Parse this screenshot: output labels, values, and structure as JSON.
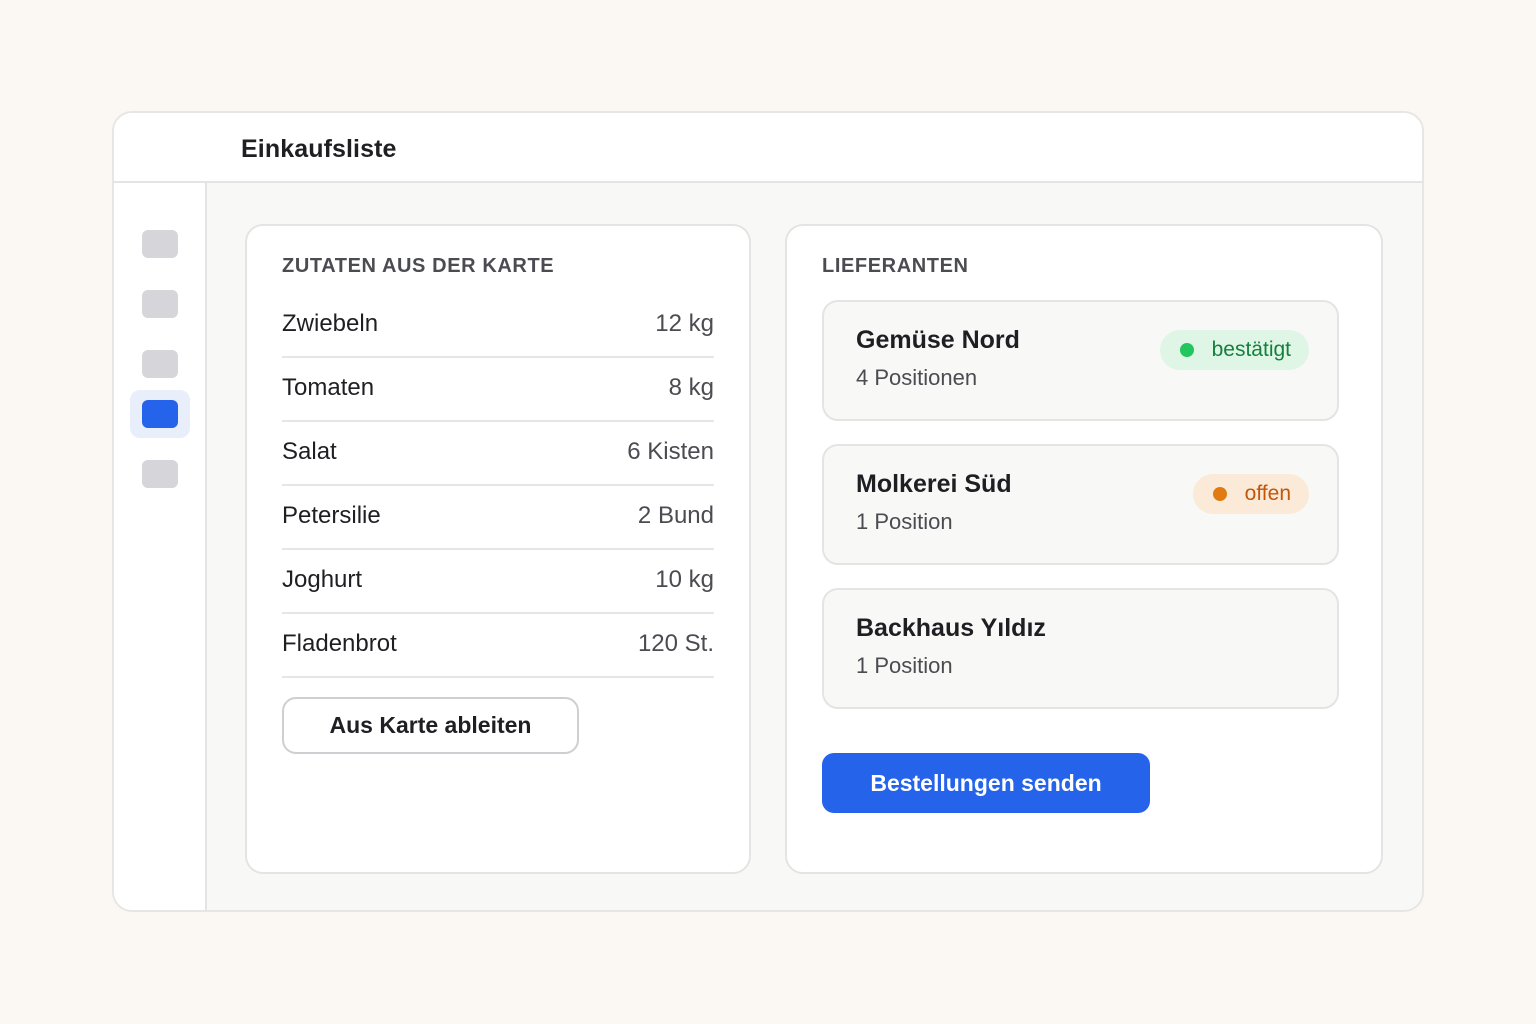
{
  "window": {
    "title": "Einkaufsliste"
  },
  "sidebar": {
    "items": [
      {
        "icon": "nav-placeholder-icon",
        "active": false
      },
      {
        "icon": "nav-placeholder-icon",
        "active": false
      },
      {
        "icon": "nav-placeholder-icon",
        "active": false
      },
      {
        "icon": "nav-placeholder-icon",
        "active": true
      },
      {
        "icon": "nav-placeholder-icon",
        "active": false
      }
    ],
    "accent_color": "#2563eb"
  },
  "ingredients": {
    "title": "ZUTATEN AUS DER KARTE",
    "items": [
      {
        "name": "Zwiebeln",
        "quantity": "12 kg"
      },
      {
        "name": "Tomaten",
        "quantity": "8 kg"
      },
      {
        "name": "Salat",
        "quantity": "6 Kisten"
      },
      {
        "name": "Petersilie",
        "quantity": "2 Bund"
      },
      {
        "name": "Joghurt",
        "quantity": "10 kg"
      },
      {
        "name": "Fladenbrot",
        "quantity": "120 St."
      }
    ],
    "derive_button_label": "Aus Karte ableiten"
  },
  "suppliers": {
    "title": "LIEFERANTEN",
    "items": [
      {
        "name": "Gemüse Nord",
        "positions": "4 Positionen",
        "status": "bestätigt",
        "status_color": "#22c55e"
      },
      {
        "name": "Molkerei Süd",
        "positions": "1 Position",
        "status": "offen",
        "status_color": "#e07b12"
      },
      {
        "name": "Backhaus Yıldız",
        "positions": "1 Position"
      }
    ],
    "send_button_label": "Bestellungen senden"
  }
}
